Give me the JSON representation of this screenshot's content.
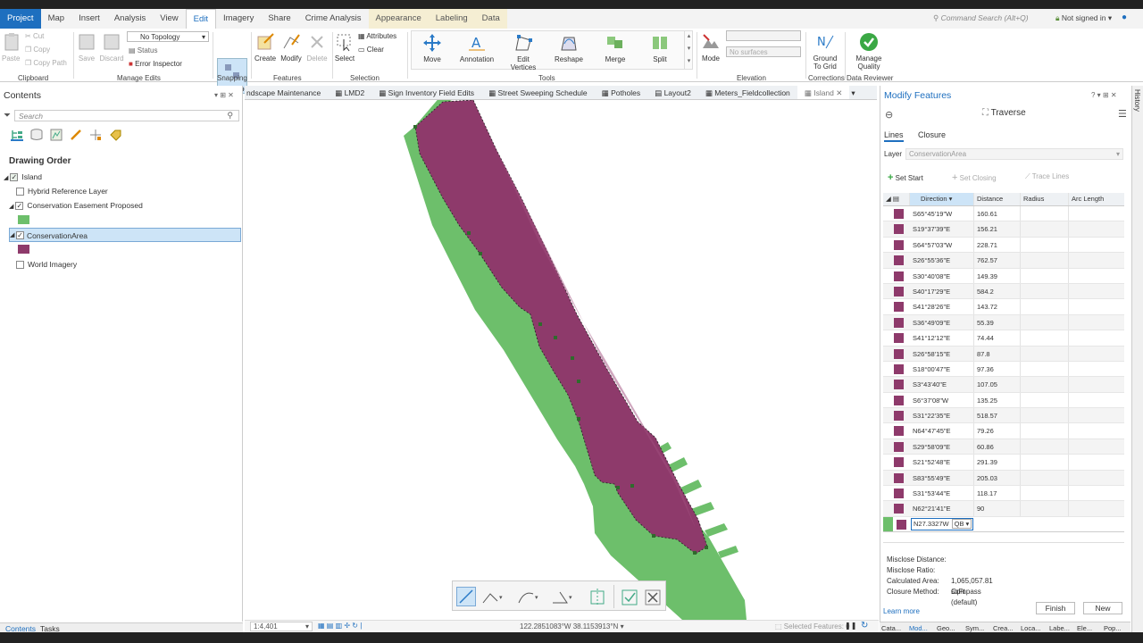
{
  "menu": {
    "tabs": [
      "Project",
      "Map",
      "Insert",
      "Analysis",
      "View",
      "Edit",
      "Imagery",
      "Share",
      "Crime Analysis",
      "Appearance",
      "Labeling",
      "Data"
    ],
    "command_search": "Command Search (Alt+Q)",
    "signin": "Not signed in"
  },
  "ribbon": {
    "paste": "Paste",
    "cut": "Cut",
    "copy": "Copy",
    "copy_path": "Copy Path",
    "save": "Save",
    "discard": "Discard",
    "topology": "No Topology",
    "status": "Status",
    "error_inspector": "Error Inspector",
    "snapping": "Snapping",
    "create": "Create",
    "modify": "Modify",
    "delete": "Delete",
    "select": "Select",
    "attributes": "Attributes",
    "clear": "Clear",
    "move": "Move",
    "annotation": "Annotation",
    "edit_vertices": "Edit\nVertices",
    "reshape": "Reshape",
    "merge": "Merge",
    "split": "Split",
    "mode": "Mode",
    "surfaces": "No surfaces",
    "ground_to_grid": "Ground\nTo Grid",
    "manage_quality": "Manage\nQuality",
    "groups": {
      "clipboard": "Clipboard",
      "manage_edits": "Manage Edits",
      "snapping": "Snapping",
      "features": "Features",
      "selection": "Selection",
      "tools": "Tools",
      "elevation": "Elevation",
      "corrections": "Corrections",
      "data_reviewer": "Data Reviewer"
    }
  },
  "contents": {
    "title": "Contents",
    "search_placeholder": "Search",
    "drawing_order": "Drawing Order",
    "layers": [
      {
        "label": "Island",
        "checked": true
      },
      {
        "label": "Hybrid Reference Layer",
        "checked": false
      },
      {
        "label": "Conservation Easement Proposed",
        "checked": true
      },
      {
        "label": "ConservationArea",
        "checked": true
      },
      {
        "label": "World Imagery",
        "checked": false
      }
    ],
    "bottom_tabs": [
      "Contents",
      "Tasks"
    ]
  },
  "map_tabs": [
    "ndscape Maintenance",
    "LMD2",
    "Sign Inventory Field Edits",
    "Street Sweeping Schedule",
    "Potholes",
    "Layout2",
    "Meters_Fieldcollection",
    "Island"
  ],
  "status": {
    "scale": "1:4,401",
    "coords": "122.2851083°W 38.1153913°N",
    "selected": "Selected Features: 0"
  },
  "modify": {
    "title": "Modify Features",
    "tool": "Traverse",
    "tabs": [
      "Lines",
      "Closure"
    ],
    "layer_label": "Layer",
    "layer_value": "ConservationArea",
    "set_start": "Set Start",
    "set_closing": "Set Closing",
    "trace_lines": "Trace Lines",
    "columns": [
      "Direction",
      "Distance",
      "Radius",
      "Arc Length"
    ],
    "rows": [
      [
        "S65°45'19\"W",
        "160.61"
      ],
      [
        "S19°37'39\"E",
        "156.21"
      ],
      [
        "S64°57'03\"W",
        "228.71"
      ],
      [
        "S26°55'36\"E",
        "762.57"
      ],
      [
        "S30°40'08\"E",
        "149.39"
      ],
      [
        "S40°17'29\"E",
        "584.2"
      ],
      [
        "S41°28'26\"E",
        "143.72"
      ],
      [
        "S36°49'09\"E",
        "55.39"
      ],
      [
        "S41°12'12\"E",
        "74.44"
      ],
      [
        "S26°58'15\"E",
        "87.8"
      ],
      [
        "S18°00'47\"E",
        "97.36"
      ],
      [
        "S3°43'40\"E",
        "107.05"
      ],
      [
        "S6°37'08\"W",
        "135.25"
      ],
      [
        "S31°22'35\"E",
        "518.57"
      ],
      [
        "N64°47'45\"E",
        "79.26"
      ],
      [
        "S29°58'09\"E",
        "60.86"
      ],
      [
        "S21°52'48\"E",
        "291.39"
      ],
      [
        "S83°55'49\"E",
        "205.03"
      ],
      [
        "S31°53'44\"E",
        "118.17"
      ],
      [
        "N62°21'41\"E",
        "90"
      ]
    ],
    "edit_value": "N27.3327W",
    "edit_type": "QB",
    "misclose_distance": "Misclose Distance:",
    "misclose_ratio": "Misclose Ratio:",
    "calculated_area_label": "Calculated Area:",
    "calculated_area_value": "1,065,057.81 sqFt",
    "closure_method_label": "Closure Method:",
    "closure_method_value": "Compass (default)",
    "learn_more": "Learn more",
    "finish": "Finish",
    "new": "New",
    "bottom_tabs": [
      "Cata...",
      "Mod...",
      "Geo...",
      "Sym...",
      "Crea...",
      "Loca...",
      "Labe...",
      "Ele...",
      "Pop..."
    ],
    "history": "History"
  },
  "colors": {
    "accent": "#1e6fbf",
    "polygon_purple": "#8e3a6b",
    "polygon_green": "#6dbf6b"
  }
}
